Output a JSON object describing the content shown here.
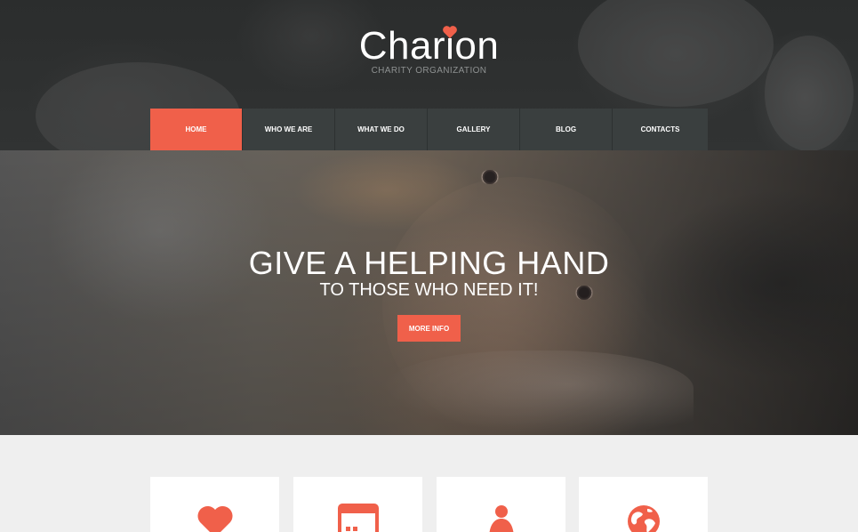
{
  "header": {
    "logo": "Charion",
    "tagline": "CHARITY ORGANIZATION"
  },
  "nav": {
    "items": [
      {
        "label": "HOME",
        "active": true
      },
      {
        "label": "WHO WE ARE",
        "active": false
      },
      {
        "label": "WHAT WE DO",
        "active": false
      },
      {
        "label": "GALLERY",
        "active": false
      },
      {
        "label": "BLOG",
        "active": false
      },
      {
        "label": "CONTACTS",
        "active": false
      }
    ]
  },
  "hero": {
    "title": "GIVE A HELPING HAND",
    "subtitle": "TO THOSE WHO NEED IT!",
    "button_label": "MORE INFO"
  },
  "features": {
    "cards": [
      {
        "icon": "heart-icon"
      },
      {
        "icon": "calendar-icon"
      },
      {
        "icon": "person-icon"
      },
      {
        "icon": "globe-icon"
      }
    ]
  },
  "colors": {
    "accent": "#f0604a",
    "nav_bg": "#3a3f3f",
    "header_bg": "#2e3030",
    "page_bg": "#efefef"
  }
}
